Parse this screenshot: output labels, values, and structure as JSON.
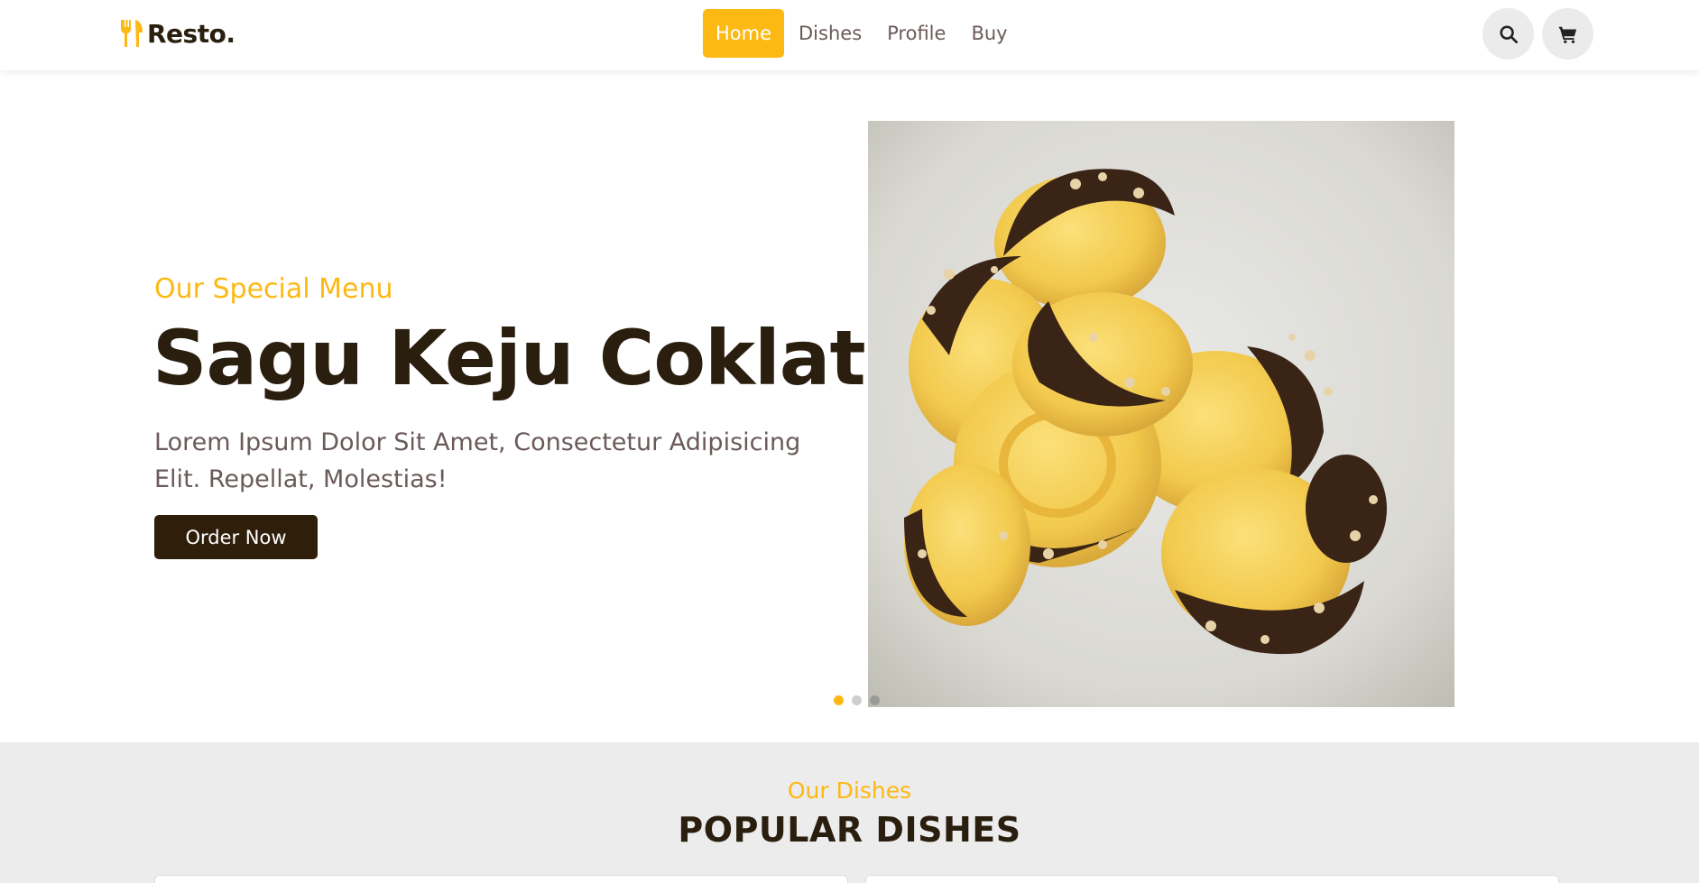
{
  "header": {
    "logo_text": "Resto.",
    "nav": [
      {
        "label": "Home",
        "active": true
      },
      {
        "label": "Dishes",
        "active": false
      },
      {
        "label": "Profile",
        "active": false
      },
      {
        "label": "Buy",
        "active": false
      }
    ],
    "icons": [
      "search-icon",
      "cart-icon"
    ]
  },
  "hero": {
    "subtitle": "Our Special Menu",
    "title": "Sagu Keju Coklat",
    "description": "Lorem Ipsum Dolor Sit Amet, Consectetur Adipisicing Elit. Repellat, Molestias!",
    "cta_label": "Order Now",
    "slides_count": 3,
    "active_slide": 1
  },
  "dishes": {
    "subtitle": "Our Dishes",
    "title": "POPULAR DISHES"
  },
  "colors": {
    "accent": "#fdb913",
    "dark": "#2f1e0a",
    "muted_text": "#6b5a5a",
    "section_bg": "#ececec"
  }
}
